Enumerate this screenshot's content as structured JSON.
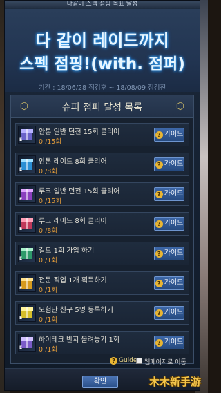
{
  "window": {
    "title": "다같이 스펙 점핑 목표 달성"
  },
  "hero": {
    "line1": "다 같이 레이드까지",
    "line2": "스펙 점핑!(with. 점퍼)",
    "period": "기간 : 18/06/28 점검후 ~ 18/08/09 점검전"
  },
  "panel": {
    "title": "슈퍼 점퍼 달성 목록",
    "guide_label": "가이드",
    "missions": [
      {
        "name": "안톤 일반 던전 15회 클리어",
        "progress": "0 /15회",
        "color": "#6a63c9",
        "accent": "#b7b2ff",
        "tag": "E"
      },
      {
        "name": "안톤 레이드 8회 클리어",
        "progress": "0 /8회",
        "color": "#2a8fd4",
        "accent": "#9fe0ff",
        "tag": "E"
      },
      {
        "name": "루크 일반 던전 15회 클리어",
        "progress": "0 /15회",
        "color": "#8b3fbf",
        "accent": "#e0a4ff",
        "tag": "E"
      },
      {
        "name": "루크 레이드 8회 클리어",
        "progress": "0 /8회",
        "color": "#c0395a",
        "accent": "#ff9fb6",
        "tag": "E"
      },
      {
        "name": "길드 1회 가입 하기",
        "progress": "0 /1회",
        "color": "#2e9a6a",
        "accent": "#a8f0c9",
        "tag": "E"
      },
      {
        "name": "전문 직업 1개 획득하기",
        "progress": "0 /1회",
        "color": "#d69a1e",
        "accent": "#ffe08a",
        "tag": "E"
      },
      {
        "name": "모험단 친구 5명 등록하기",
        "progress": "0 /1회",
        "color": "#d6be2a",
        "accent": "#fff39a",
        "tag": "E"
      },
      {
        "name": "하이테크 반지 올려놓기 1회",
        "progress": "0 /1회",
        "color": "#7b5cc8",
        "accent": "#d0c0ff",
        "tag": "E"
      }
    ]
  },
  "footer": {
    "guide_link": "Guide",
    "web_link": "웹페이지로 이동",
    "ok_label": "확인"
  },
  "watermark": "木木新手游"
}
